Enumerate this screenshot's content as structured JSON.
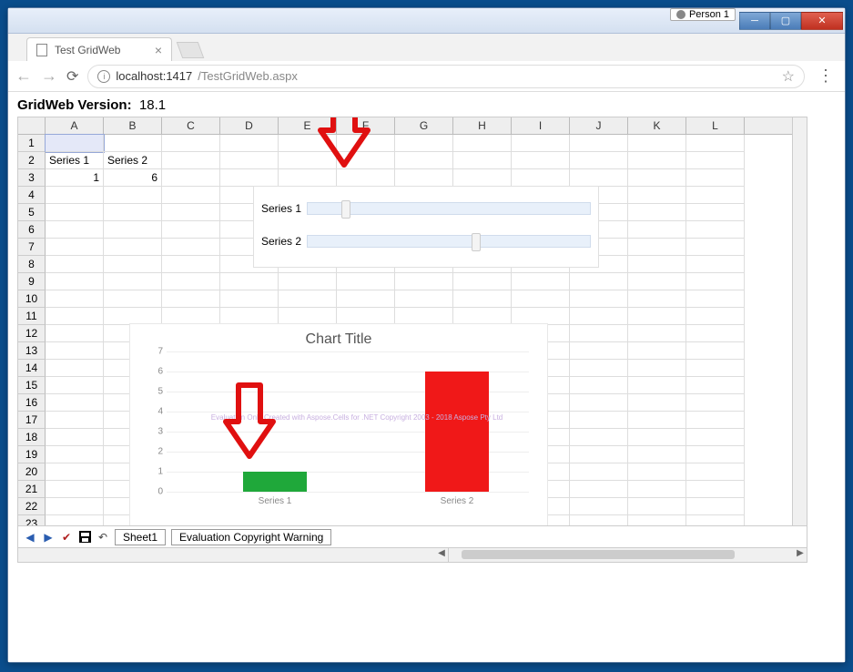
{
  "window": {
    "person_label": "Person 1"
  },
  "browser": {
    "tab_title": "Test GridWeb",
    "url_host": "localhost:",
    "url_port": "1417",
    "url_path": "/TestGridWeb.aspx"
  },
  "page": {
    "version_label": "GridWeb Version:",
    "version_value": "18.1"
  },
  "grid": {
    "columns": [
      "A",
      "B",
      "C",
      "D",
      "E",
      "F",
      "G",
      "H",
      "I",
      "J",
      "K",
      "L"
    ],
    "rows_count": 24,
    "cells": {
      "A2": "Series 1",
      "B2": "Series 2",
      "A3": "1",
      "B3": "6"
    }
  },
  "slider_chart": {
    "rows": [
      {
        "label": "Series 1",
        "pos_pct": 12
      },
      {
        "label": "Series 2",
        "pos_pct": 58
      }
    ]
  },
  "chart_data": {
    "type": "bar",
    "title": "Chart Title",
    "categories": [
      "Series 1",
      "Series 2"
    ],
    "values": [
      1,
      6
    ],
    "colors": [
      "#1fa83a",
      "#f01818"
    ],
    "ylim": [
      0,
      7
    ],
    "yticks": [
      0,
      1,
      2,
      3,
      4,
      5,
      6,
      7
    ],
    "watermark": "Evaluation Only Created with Aspose.Cells for .NET Copyright 2003 - 2018 Aspose Pty Ltd"
  },
  "bottombar": {
    "sheet_tab": "Sheet1",
    "eval_tab": "Evaluation Copyright Warning"
  }
}
